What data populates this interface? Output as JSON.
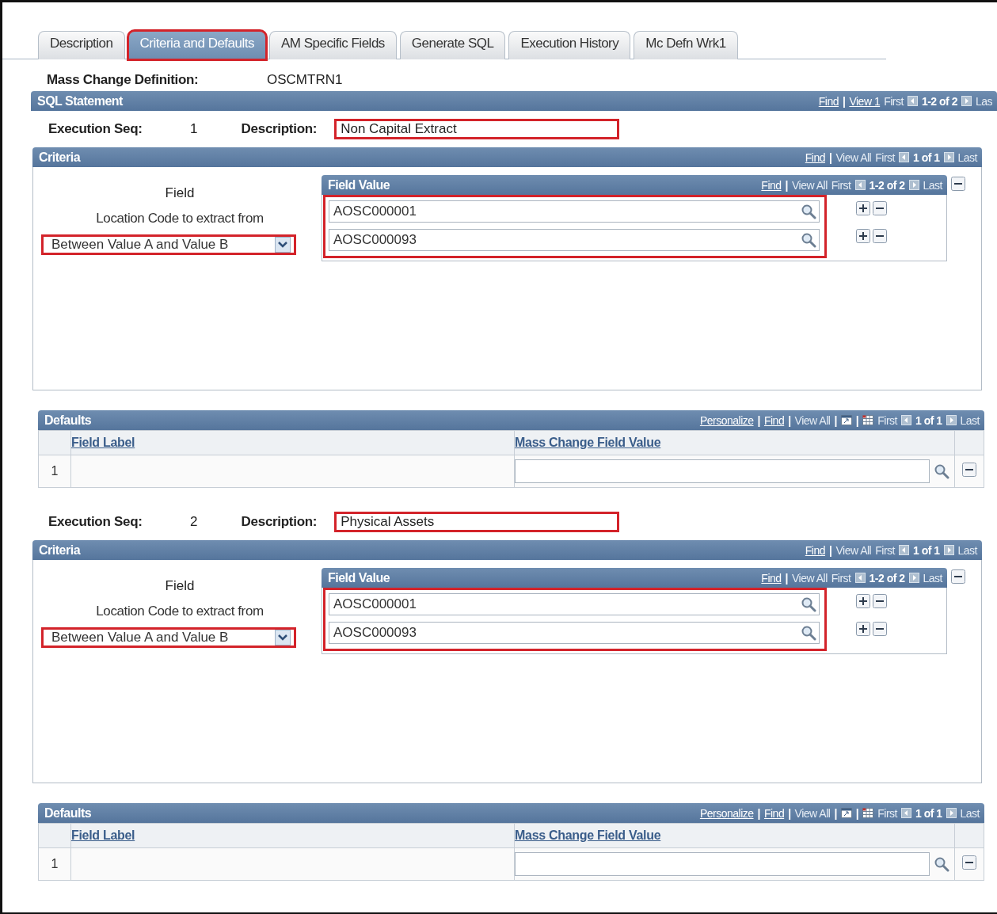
{
  "tabs": [
    {
      "label": "Description",
      "selected": false,
      "highlighted": false
    },
    {
      "label": "Criteria and Defaults",
      "selected": true,
      "highlighted": true
    },
    {
      "label": "AM Specific Fields",
      "selected": false,
      "highlighted": false
    },
    {
      "label": "Generate SQL",
      "selected": false,
      "highlighted": false
    },
    {
      "label": "Execution History",
      "selected": false,
      "highlighted": false
    },
    {
      "label": "Mc Defn Wrk1",
      "selected": false,
      "highlighted": false
    }
  ],
  "definition": {
    "label": "Mass Change Definition:",
    "value": "OSCMTRN1"
  },
  "sql_statement": {
    "title": "SQL Statement",
    "nav": [
      {
        "kind": "link",
        "text": "Find"
      },
      {
        "kind": "sep",
        "text": "|"
      },
      {
        "kind": "link",
        "text": "View 1"
      },
      {
        "kind": "muted",
        "text": "First"
      },
      {
        "kind": "prev"
      },
      {
        "kind": "count",
        "text": "1-2 of 2"
      },
      {
        "kind": "next"
      },
      {
        "kind": "muted",
        "text": "Las"
      }
    ]
  },
  "statements": [
    {
      "seq_label": "Execution Seq:",
      "seq": "1",
      "desc_label": "Description:",
      "description": "Non Capital Extract",
      "highlighted": true,
      "criteria": {
        "title": "Criteria",
        "nav": [
          {
            "kind": "link",
            "text": "Find"
          },
          {
            "kind": "sep",
            "text": "|"
          },
          {
            "kind": "muted",
            "text": "View All"
          },
          {
            "kind": "muted",
            "text": "First"
          },
          {
            "kind": "prev"
          },
          {
            "kind": "count",
            "text": "1 of 1"
          },
          {
            "kind": "next"
          },
          {
            "kind": "muted",
            "text": "Last"
          }
        ],
        "field_heading": "Field",
        "field_name": "Location Code to extract from",
        "operator": "Between Value A and Value B",
        "operator_highlighted": true,
        "field_value": {
          "title": "Field Value",
          "highlighted": true,
          "nav": [
            {
              "kind": "link",
              "text": "Find"
            },
            {
              "kind": "sep",
              "text": "|"
            },
            {
              "kind": "muted",
              "text": "View All"
            },
            {
              "kind": "muted",
              "text": "First"
            },
            {
              "kind": "prev"
            },
            {
              "kind": "count",
              "text": "1-2 of 2"
            },
            {
              "kind": "next"
            },
            {
              "kind": "muted",
              "text": "Last"
            }
          ],
          "rows": [
            "AOSC000001",
            "AOSC000093"
          ]
        }
      },
      "defaults": {
        "title": "Defaults",
        "nav": [
          {
            "kind": "link",
            "text": "Personalize"
          },
          {
            "kind": "sep",
            "text": "|"
          },
          {
            "kind": "link",
            "text": "Find"
          },
          {
            "kind": "sep",
            "text": "|"
          },
          {
            "kind": "muted",
            "text": "View All"
          },
          {
            "kind": "sep",
            "text": "|"
          },
          {
            "kind": "zoom"
          },
          {
            "kind": "sep",
            "text": "|"
          },
          {
            "kind": "grid"
          },
          {
            "kind": "muted",
            "text": "First"
          },
          {
            "kind": "prev"
          },
          {
            "kind": "count",
            "text": "1 of 1"
          },
          {
            "kind": "next"
          },
          {
            "kind": "muted",
            "text": "Last"
          }
        ],
        "columns": [
          "Field Label",
          "Mass Change Field Value"
        ],
        "rows": [
          {
            "number": "1"
          }
        ]
      }
    },
    {
      "seq_label": "Execution Seq:",
      "seq": "2",
      "desc_label": "Description:",
      "description": "Physical Assets",
      "highlighted": true,
      "criteria": {
        "title": "Criteria",
        "nav": [
          {
            "kind": "link",
            "text": "Find"
          },
          {
            "kind": "sep",
            "text": "|"
          },
          {
            "kind": "muted",
            "text": "View All"
          },
          {
            "kind": "muted",
            "text": "First"
          },
          {
            "kind": "prev"
          },
          {
            "kind": "count",
            "text": "1 of 1"
          },
          {
            "kind": "next"
          },
          {
            "kind": "muted",
            "text": "Last"
          }
        ],
        "field_heading": "Field",
        "field_name": "Location Code to extract from",
        "operator": "Between Value A and Value B",
        "operator_highlighted": true,
        "field_value": {
          "title": "Field Value",
          "highlighted": true,
          "nav": [
            {
              "kind": "link",
              "text": "Find"
            },
            {
              "kind": "sep",
              "text": "|"
            },
            {
              "kind": "muted",
              "text": "View All"
            },
            {
              "kind": "muted",
              "text": "First"
            },
            {
              "kind": "prev"
            },
            {
              "kind": "count",
              "text": "1-2 of 2"
            },
            {
              "kind": "next"
            },
            {
              "kind": "muted",
              "text": "Last"
            }
          ],
          "rows": [
            "AOSC000001",
            "AOSC000093"
          ]
        }
      },
      "defaults": {
        "title": "Defaults",
        "nav": [
          {
            "kind": "link",
            "text": "Personalize"
          },
          {
            "kind": "sep",
            "text": "|"
          },
          {
            "kind": "link",
            "text": "Find"
          },
          {
            "kind": "sep",
            "text": "|"
          },
          {
            "kind": "muted",
            "text": "View All"
          },
          {
            "kind": "sep",
            "text": "|"
          },
          {
            "kind": "zoom"
          },
          {
            "kind": "sep",
            "text": "|"
          },
          {
            "kind": "grid"
          },
          {
            "kind": "muted",
            "text": "First"
          },
          {
            "kind": "prev"
          },
          {
            "kind": "count",
            "text": "1 of 1"
          },
          {
            "kind": "next"
          },
          {
            "kind": "muted",
            "text": "Last"
          }
        ],
        "columns": [
          "Field Label",
          "Mass Change Field Value"
        ],
        "rows": [
          {
            "number": "1"
          }
        ]
      }
    }
  ]
}
